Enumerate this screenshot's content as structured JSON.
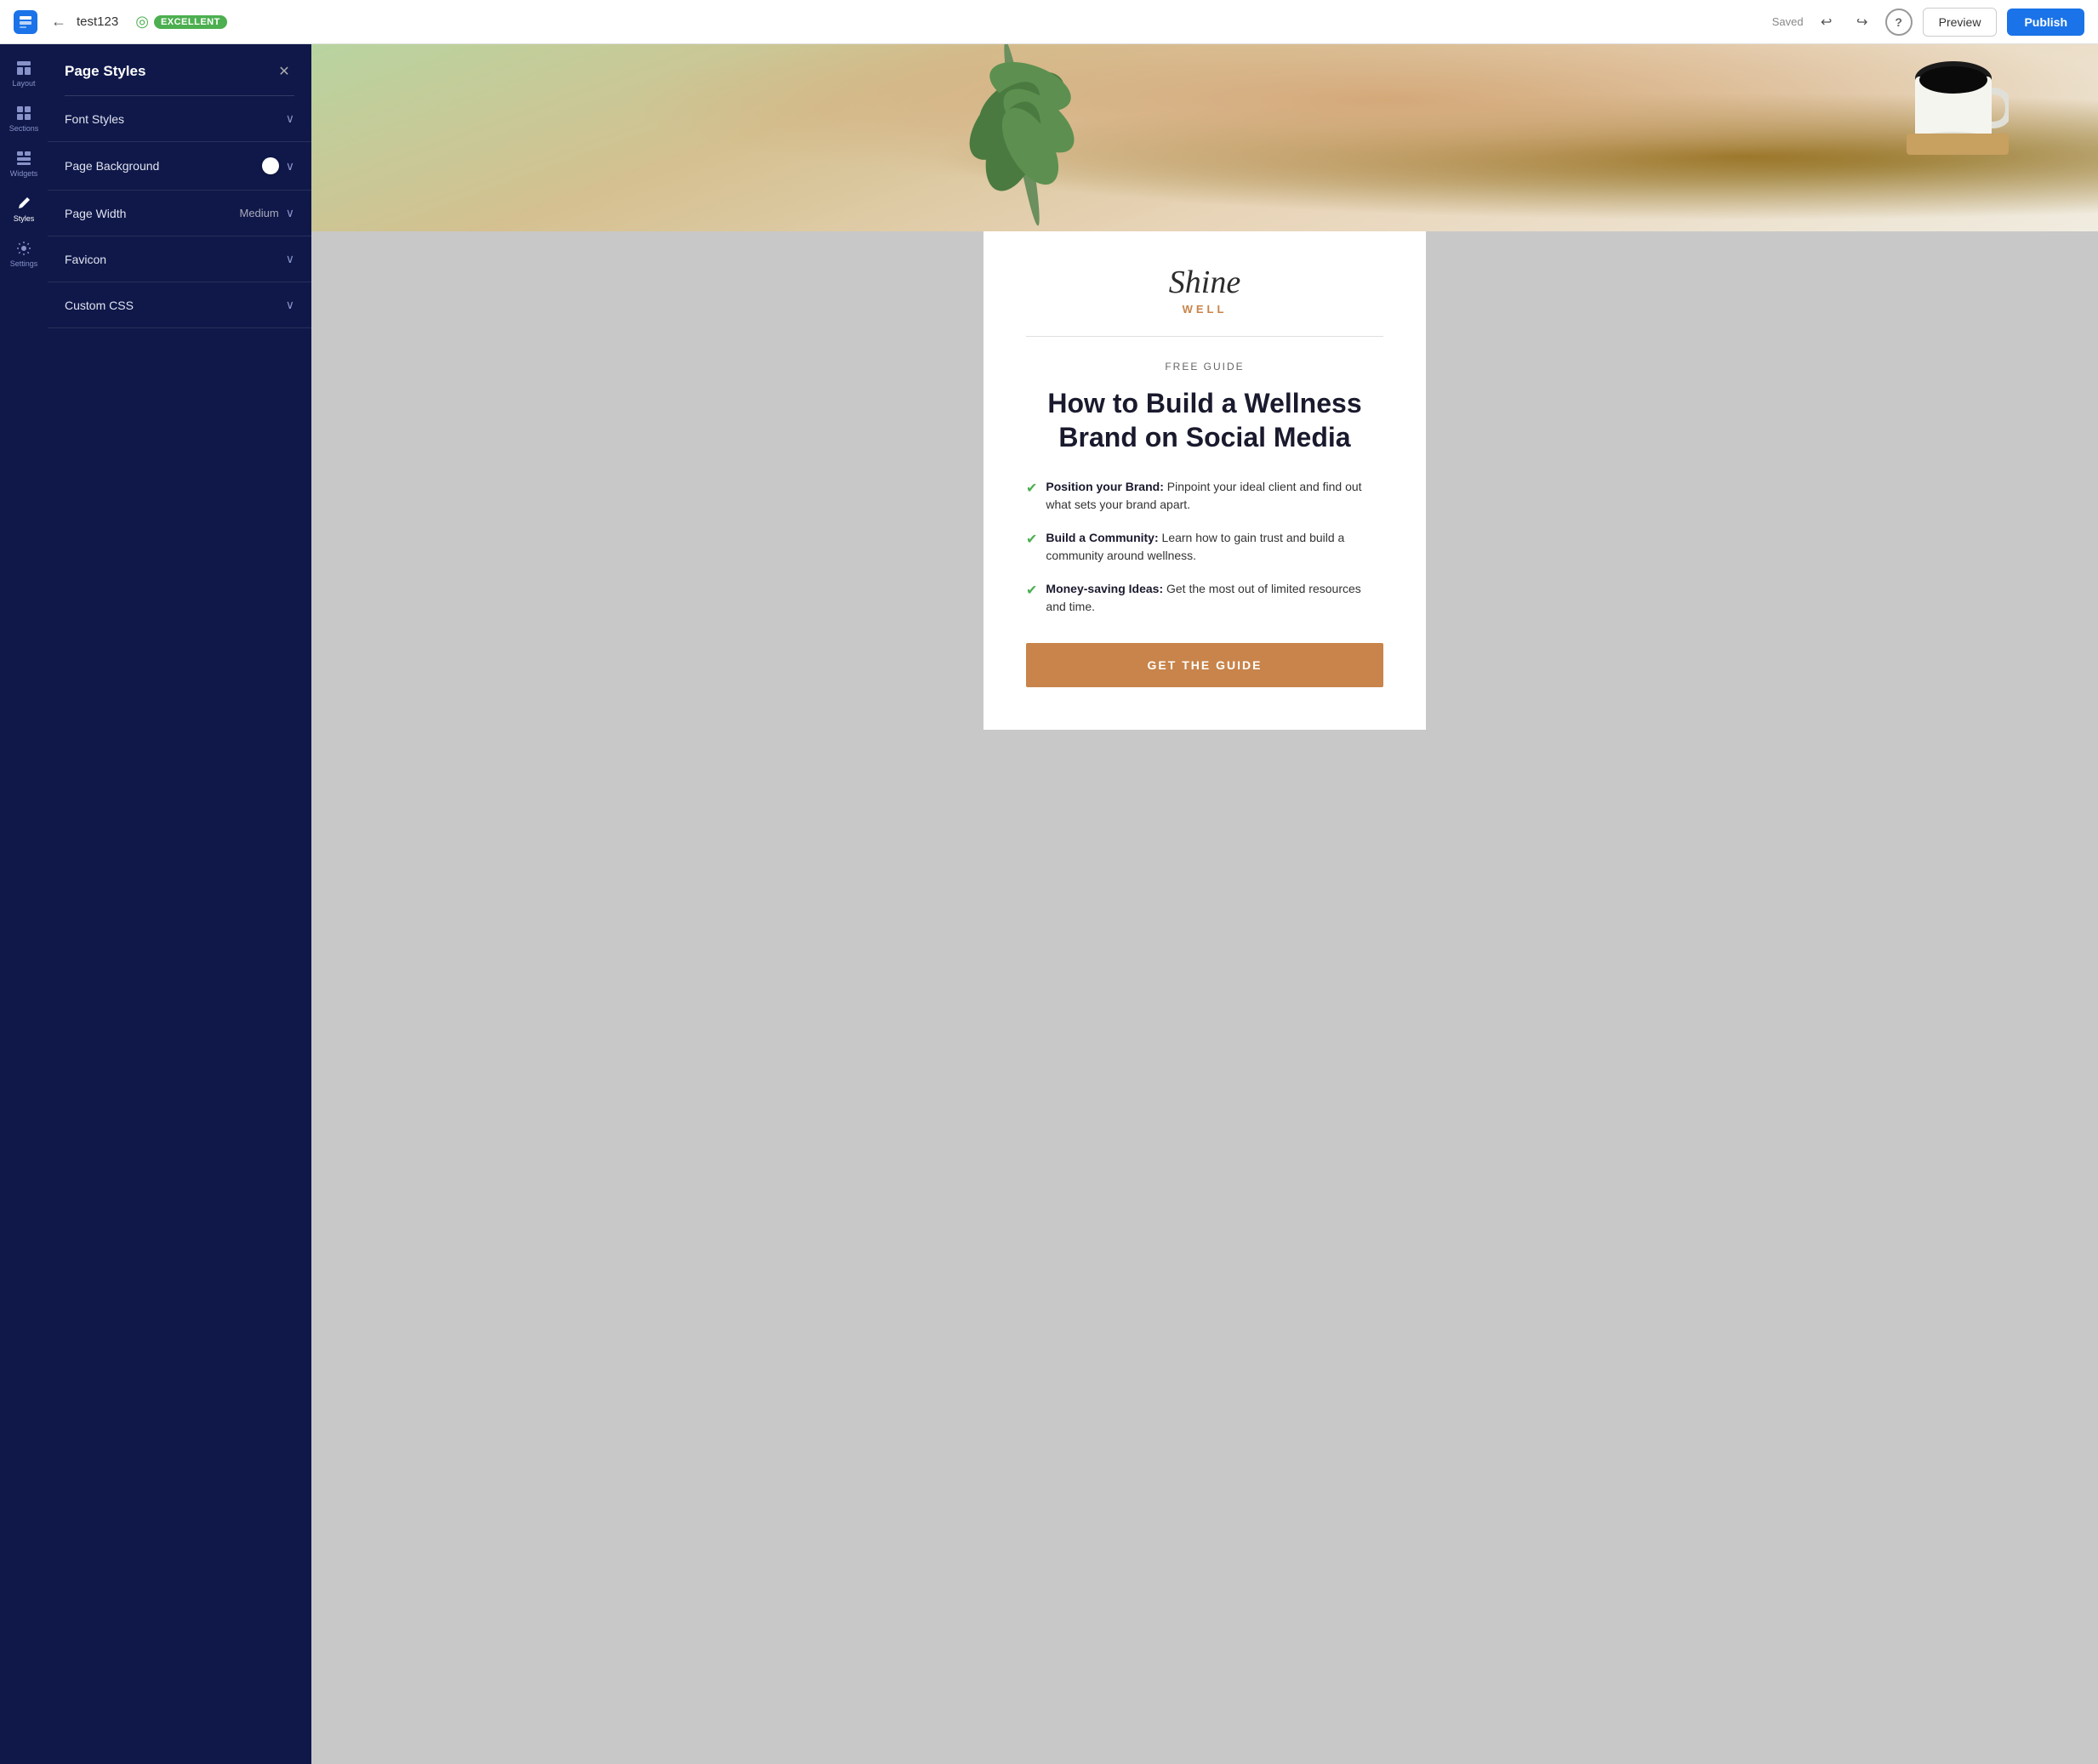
{
  "topbar": {
    "logo_label": "S",
    "back_icon": "←",
    "title": "test123",
    "target_icon": "◎",
    "badge": "EXCELLENT",
    "saved": "Saved",
    "undo_icon": "↩",
    "redo_icon": "↪",
    "help_icon": "?",
    "preview_label": "Preview",
    "publish_label": "Publish"
  },
  "icon_sidebar": {
    "items": [
      {
        "id": "layout",
        "icon": "▤",
        "label": "Layout"
      },
      {
        "id": "sections",
        "icon": "▦",
        "label": "Sections"
      },
      {
        "id": "widgets",
        "icon": "⊞",
        "label": "Widgets"
      },
      {
        "id": "styles",
        "icon": "✏",
        "label": "Styles",
        "active": true
      },
      {
        "id": "settings",
        "icon": "⚙",
        "label": "Settings"
      }
    ]
  },
  "panel": {
    "title": "Page Styles",
    "close_icon": "✕",
    "items": [
      {
        "id": "font-styles",
        "label": "Font Styles",
        "value": "",
        "has_toggle": false
      },
      {
        "id": "page-background",
        "label": "Page Background",
        "value": "",
        "has_toggle": true
      },
      {
        "id": "page-width",
        "label": "Page Width",
        "value": "Medium",
        "has_toggle": false
      },
      {
        "id": "favicon",
        "label": "Favicon",
        "value": "",
        "has_toggle": false
      },
      {
        "id": "custom-css",
        "label": "Custom CSS",
        "value": "",
        "has_toggle": false
      }
    ]
  },
  "content": {
    "brand_shine": "Shine",
    "brand_well": "WELL",
    "free_guide": "FREE GUIDE",
    "heading": "How to Build a Wellness Brand on Social Media",
    "checklist": [
      {
        "bold": "Position your Brand:",
        "text": " Pinpoint your ideal client and find out what sets your brand apart."
      },
      {
        "bold": "Build a Community:",
        "text": " Learn how to gain trust and build a community around wellness."
      },
      {
        "bold": "Money-saving Ideas:",
        "text": " Get the most out of limited resources and time."
      }
    ],
    "cta_label": "GET THE GUIDE"
  }
}
